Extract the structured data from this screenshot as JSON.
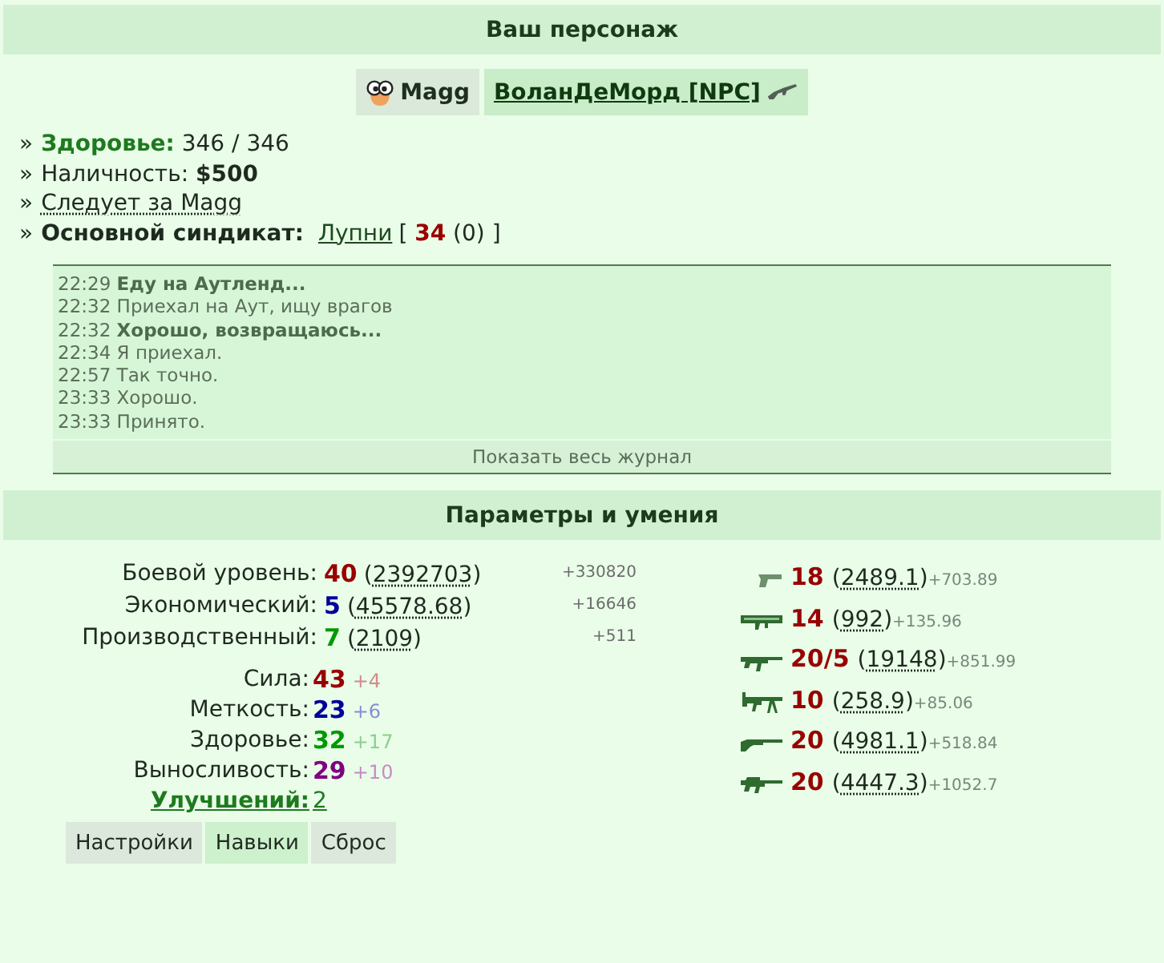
{
  "header": {
    "title": "Ваш персонаж"
  },
  "players": [
    {
      "kind": "self",
      "name": "Magg"
    },
    {
      "kind": "npc",
      "name": "ВоланДеМорд [NPC]"
    }
  ],
  "info": [
    {
      "kind": "health",
      "bullet": "»",
      "text": "**Здоровье:** 346 / 346"
    },
    {
      "kind": "cash",
      "bullet": "»",
      "text": "Наличность: **$500**"
    },
    {
      "kind": "follow",
      "bullet": "»",
      "text": "Следует за Magg"
    },
    {
      "kind": "syndicate",
      "bullet": "»",
      "text": "Основной синдикат:",
      "link": "Лупни",
      "rank": "[ **34** (0) ]"
    }
  ],
  "log": {
    "entries": [
      {
        "time": "22:29",
        "text": "Еду на Аутленд...",
        "bold": true
      },
      {
        "time": "22:32",
        "text": "Приехал на Аут, ищу врагов",
        "bold": false
      },
      {
        "time": "22:32",
        "text": "Хорошо, возвращаюсь...",
        "bold": true
      },
      {
        "time": "22:34",
        "text": "Я приехал.",
        "bold": false
      },
      {
        "time": "22:57",
        "text": "Так точно.",
        "bold": false
      },
      {
        "time": "23:33",
        "text": "Хорошо.",
        "bold": false
      },
      {
        "time": "23:33",
        "text": "Принято.",
        "bold": false
      }
    ],
    "show_all": "Показать весь журнал"
  },
  "params": {
    "title": "Параметры и умения"
  },
  "levels": [
    {
      "label": "Боевой уровень:",
      "value": "40",
      "exp": "(2392703)",
      "gain": "+330820",
      "color": "#990000"
    },
    {
      "label": "Экономический:",
      "value": "5",
      "exp": "(45578.68)",
      "gain": "+16646",
      "color": "#000099"
    },
    {
      "label": "Производственный:",
      "value": "7",
      "exp": "(2109)",
      "gain": "+511",
      "color": "#009900"
    }
  ],
  "stats": [
    {
      "label": "Сила:",
      "value": "43",
      "bonus": "+4",
      "color": "#990000"
    },
    {
      "label": "Меткость:",
      "value": "23",
      "bonus": "+6",
      "color": "#000099"
    },
    {
      "label": "Здоровье:",
      "value": "32",
      "bonus": "+17",
      "color": "#009900"
    },
    {
      "label": "Выносливость:",
      "value": "29",
      "bonus": "+10",
      "color": "#800080"
    }
  ],
  "upgrades": {
    "label": "Улучшений:",
    "value": "2"
  },
  "buttons": [
    {
      "label": "Настройки",
      "selected": false
    },
    {
      "label": "Навыки",
      "selected": true
    },
    {
      "label": "Сброс",
      "selected": false
    }
  ],
  "skills": [
    {
      "kind": "pistol",
      "level": "18",
      "exp": "(2489.1)",
      "gain": "+703.89"
    },
    {
      "kind": "launcher",
      "level": "14",
      "exp": "(992)",
      "gain": "+135.96"
    },
    {
      "kind": "rifle",
      "level": "20/5",
      "exp": "(19148)",
      "gain": "+851.99"
    },
    {
      "kind": "machinegun",
      "level": "10",
      "exp": "(258.9)",
      "gain": "+85.06"
    },
    {
      "kind": "shotgun",
      "level": "20",
      "exp": "(4981.1)",
      "gain": "+518.84"
    },
    {
      "kind": "sniper",
      "level": "20",
      "exp": "(4447.3)",
      "gain": "+1052.7"
    }
  ]
}
